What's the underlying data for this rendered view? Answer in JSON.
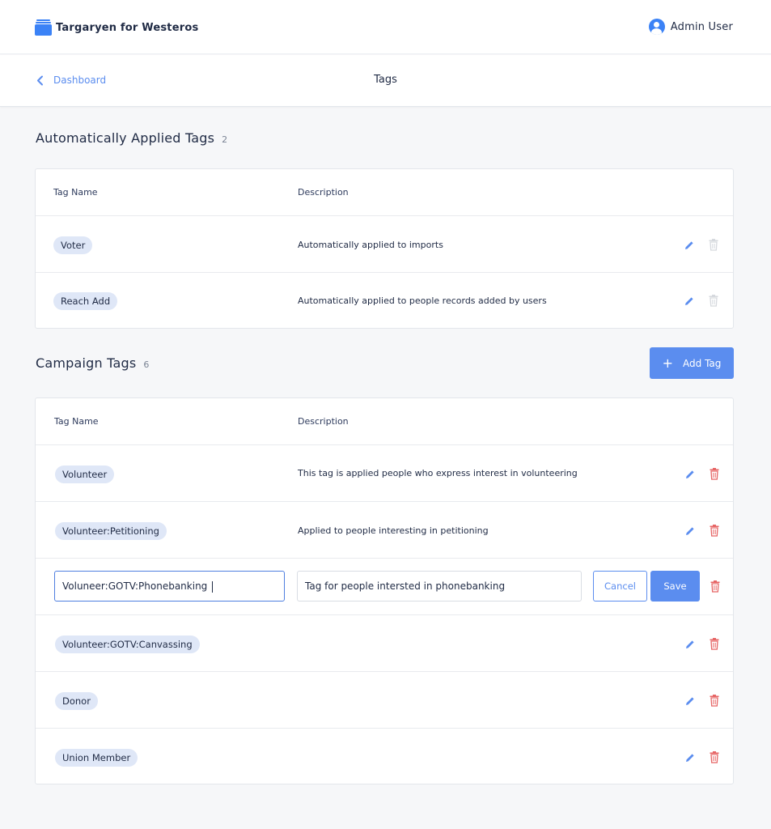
{
  "app": {
    "name": "Targaryen for Westeros"
  },
  "user": {
    "name": "Admin User"
  },
  "nav": {
    "back_label": "Dashboard",
    "page_title": "Tags"
  },
  "auto_section": {
    "title": "Automatically Applied Tags",
    "count": "2",
    "col_tag": "Tag Name",
    "col_desc": "Description",
    "rows": [
      {
        "tag": "Voter",
        "description": "Automatically applied to imports"
      },
      {
        "tag": "Reach Add",
        "description": "Automatically applied to people records added by users"
      }
    ]
  },
  "campaign_section": {
    "title": "Campaign Tags",
    "count": "6",
    "add_label": "Add Tag",
    "col_tag": "Tag Name",
    "col_desc": "Description",
    "rows": [
      {
        "tag": "Volunteer",
        "description": "This tag is applied people who express interest in volunteering"
      },
      {
        "tag": "Volunteer:Petitioning",
        "description": "Applied to people interesting in petitioning"
      },
      {
        "tag": "",
        "description": ""
      },
      {
        "tag": "Volunteer:GOTV:Canvassing",
        "description": ""
      },
      {
        "tag": "Donor",
        "description": ""
      },
      {
        "tag": "Union Member",
        "description": ""
      }
    ],
    "edit_row": {
      "tag_value": "Voluneer:GOTV:Phonebanking ",
      "desc_value": "Tag for people intersted in phonebanking",
      "cancel_label": "Cancel",
      "save_label": "Save"
    }
  },
  "colors": {
    "accent": "#5b8def",
    "brand": "#3b82f6",
    "delete": "#e66565",
    "delete_disabled": "#d6d9de",
    "chip_bg": "#dfe7f7"
  },
  "icons": {
    "brand": "folder-icon",
    "user": "user-circle-icon",
    "back": "chevron-left-icon",
    "edit": "pencil-icon",
    "delete": "trash-icon",
    "add": "plus-icon"
  }
}
